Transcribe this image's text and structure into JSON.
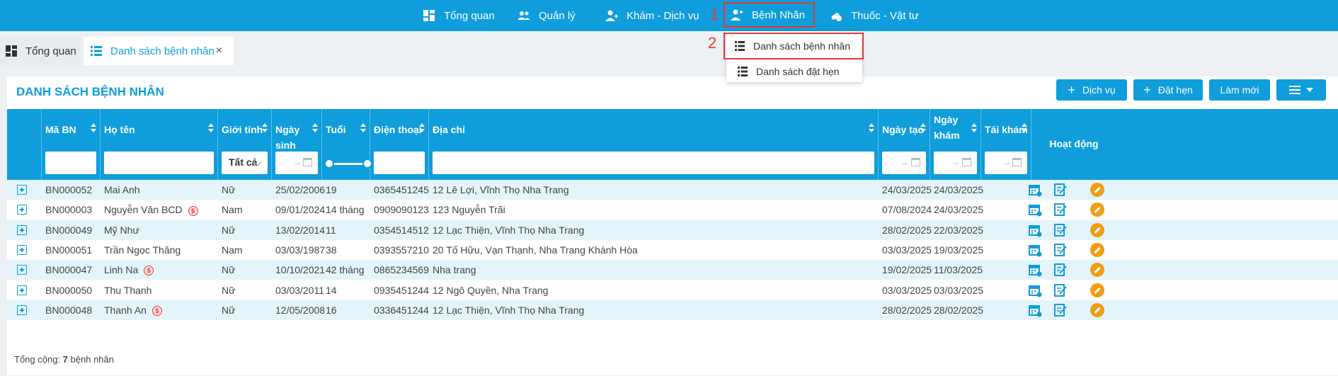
{
  "nav": {
    "items": [
      {
        "label": "Tổng quan",
        "icon": "dashboard-icon"
      },
      {
        "label": "Quản lý",
        "icon": "users-icon"
      },
      {
        "label": "Khám - Dịch vụ",
        "icon": "doctor-icon"
      },
      {
        "label": "Bệnh Nhân",
        "icon": "patient-icon"
      },
      {
        "label": "Thuốc - Vật tư",
        "icon": "pills-icon"
      }
    ]
  },
  "annotations": {
    "step1": "1",
    "step2": "2"
  },
  "dropdown": {
    "items": [
      {
        "label": "Danh sách bệnh nhân",
        "icon": "list-icon"
      },
      {
        "label": "Danh sách đặt hẹn",
        "icon": "list-icon"
      }
    ]
  },
  "tabs": [
    {
      "label": "Tổng quan"
    },
    {
      "label": "Danh sách bệnh nhân",
      "close": "×"
    }
  ],
  "panel": {
    "title": "DANH SÁCH BỆNH NHÂN",
    "buttons": {
      "service": "Dịch vụ",
      "appointment": "Đặt hẹn",
      "refresh": "Làm mới"
    }
  },
  "table": {
    "headers": {
      "code": "Mã BN",
      "name": "Họ tên",
      "gender": "Giới tính",
      "dob": "Ngày sinh",
      "age": "Tuổi",
      "phone": "Điện thoại",
      "address": "Địa chỉ",
      "created": "Ngày tạo",
      "visit_1": "Ngày",
      "visit_2": "khám",
      "revisit": "Tái khám",
      "actions": "Hoạt động"
    },
    "filters": {
      "gender": "Tất cả",
      "date_arrow": "→"
    },
    "rows": [
      {
        "code": "BN000052",
        "name": "Mai Anh",
        "badge": false,
        "gender": "Nữ",
        "dob": "25/02/2006",
        "age": "19",
        "phone": "0365451245",
        "address": "12 Lê Lợi, Vĩnh Thọ Nha Trang",
        "created": "24/03/2025",
        "visit": "24/03/2025"
      },
      {
        "code": "BN000003",
        "name": "Nguyễn Văn BCD",
        "badge": true,
        "gender": "Nam",
        "dob": "09/01/2024",
        "age": "14 tháng",
        "phone": "0909090123",
        "address": "123 Nguyễn Trãi",
        "created": "07/08/2024",
        "visit": "24/03/2025"
      },
      {
        "code": "BN000049",
        "name": "Mỹ Như",
        "badge": false,
        "gender": "Nữ",
        "dob": "13/02/2014",
        "age": "11",
        "phone": "0354514512",
        "address": "12 Lạc Thiện, Vĩnh Thọ Nha Trang",
        "created": "28/02/2025",
        "visit": "22/03/2025"
      },
      {
        "code": "BN000051",
        "name": "Trần Ngọc Thăng",
        "badge": false,
        "gender": "Nam",
        "dob": "03/03/1987",
        "age": "38",
        "phone": "0393557210",
        "address": "20 Tố Hữu, Vạn Thạnh, Nha Trang Khánh Hòa",
        "created": "03/03/2025",
        "visit": "19/03/2025"
      },
      {
        "code": "BN000047",
        "name": "Linh Na",
        "badge": true,
        "gender": "Nữ",
        "dob": "10/10/2021",
        "age": "42 tháng",
        "phone": "0865234569",
        "address": "Nha trang",
        "created": "19/02/2025",
        "visit": "11/03/2025"
      },
      {
        "code": "BN000050",
        "name": "Thu Thanh",
        "badge": false,
        "gender": "Nữ",
        "dob": "03/03/2011",
        "age": "14",
        "phone": "0935451244",
        "address": "12 Ngô Quyền, Nha Trang",
        "created": "03/03/2025",
        "visit": "03/03/2025"
      },
      {
        "code": "BN000048",
        "name": "Thanh An",
        "badge": true,
        "gender": "Nữ",
        "dob": "12/05/2008",
        "age": "16",
        "phone": "0336451244",
        "address": "12 Lạc Thiện, Vĩnh Thọ Nha Trang",
        "created": "28/02/2025",
        "visit": "28/02/2025"
      }
    ],
    "badge_symbol": "$"
  },
  "footer": {
    "prefix": "Tổng cộng:",
    "count": "7",
    "suffix": "bệnh nhân"
  },
  "colors": {
    "primary": "#0f9ddb",
    "highlight": "#e53935",
    "edit": "#f39c12"
  }
}
